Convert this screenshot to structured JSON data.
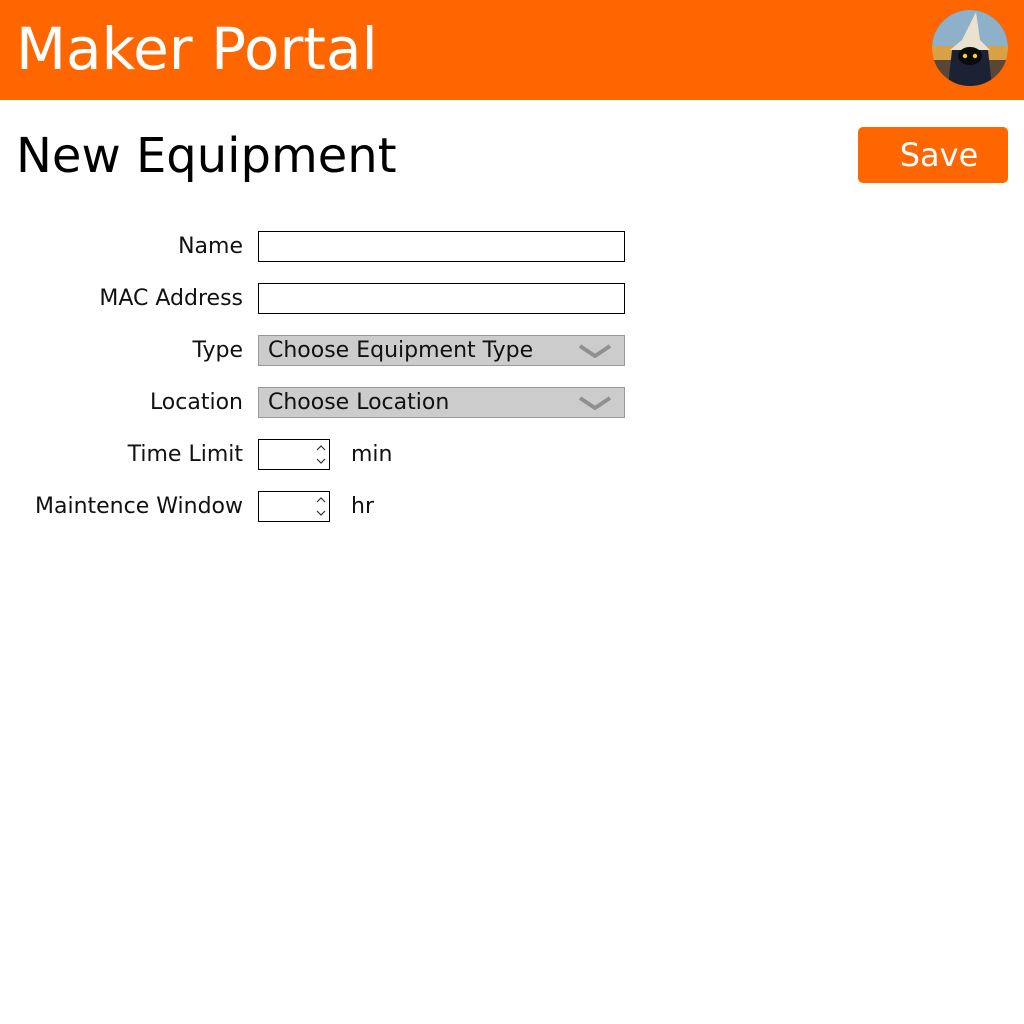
{
  "header": {
    "title": "Maker Portal",
    "background_color": "#ff6600",
    "avatar_icon": "user-avatar-icon"
  },
  "page": {
    "title": "New Equipment",
    "save_label": "Save",
    "accent_color": "#ff6600"
  },
  "form": {
    "name": {
      "label": "Name",
      "value": ""
    },
    "mac_address": {
      "label": "MAC Address",
      "value": ""
    },
    "type": {
      "label": "Type",
      "selected": "Choose Equipment Type",
      "icon": "chevron-down-icon"
    },
    "location": {
      "label": "Location",
      "selected": "Choose Location",
      "icon": "chevron-down-icon"
    },
    "time_limit": {
      "label": "Time Limit",
      "value": "",
      "unit": "min",
      "icon": "spinner-icon"
    },
    "maintenance_window": {
      "label": "Maintence Window",
      "value": "",
      "unit": "hr",
      "icon": "spinner-icon"
    }
  }
}
